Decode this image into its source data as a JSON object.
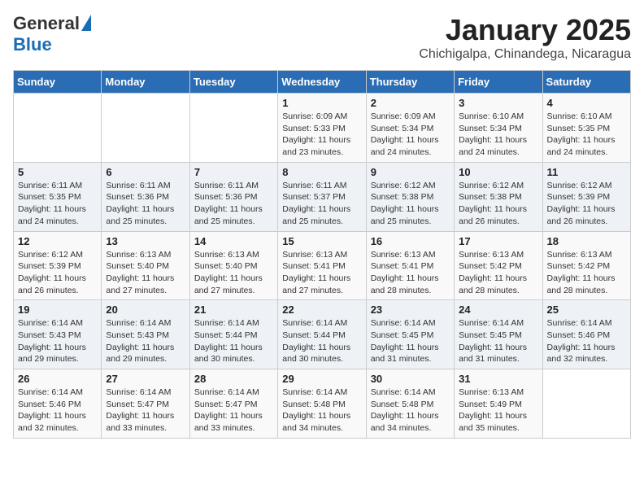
{
  "logo": {
    "general": "General",
    "blue": "Blue"
  },
  "title": "January 2025",
  "subtitle": "Chichigalpa, Chinandega, Nicaragua",
  "days_of_week": [
    "Sunday",
    "Monday",
    "Tuesday",
    "Wednesday",
    "Thursday",
    "Friday",
    "Saturday"
  ],
  "weeks": [
    [
      {
        "day": "",
        "info": ""
      },
      {
        "day": "",
        "info": ""
      },
      {
        "day": "",
        "info": ""
      },
      {
        "day": "1",
        "info": "Sunrise: 6:09 AM\nSunset: 5:33 PM\nDaylight: 11 hours and 23 minutes."
      },
      {
        "day": "2",
        "info": "Sunrise: 6:09 AM\nSunset: 5:34 PM\nDaylight: 11 hours and 24 minutes."
      },
      {
        "day": "3",
        "info": "Sunrise: 6:10 AM\nSunset: 5:34 PM\nDaylight: 11 hours and 24 minutes."
      },
      {
        "day": "4",
        "info": "Sunrise: 6:10 AM\nSunset: 5:35 PM\nDaylight: 11 hours and 24 minutes."
      }
    ],
    [
      {
        "day": "5",
        "info": "Sunrise: 6:11 AM\nSunset: 5:35 PM\nDaylight: 11 hours and 24 minutes."
      },
      {
        "day": "6",
        "info": "Sunrise: 6:11 AM\nSunset: 5:36 PM\nDaylight: 11 hours and 25 minutes."
      },
      {
        "day": "7",
        "info": "Sunrise: 6:11 AM\nSunset: 5:36 PM\nDaylight: 11 hours and 25 minutes."
      },
      {
        "day": "8",
        "info": "Sunrise: 6:11 AM\nSunset: 5:37 PM\nDaylight: 11 hours and 25 minutes."
      },
      {
        "day": "9",
        "info": "Sunrise: 6:12 AM\nSunset: 5:38 PM\nDaylight: 11 hours and 25 minutes."
      },
      {
        "day": "10",
        "info": "Sunrise: 6:12 AM\nSunset: 5:38 PM\nDaylight: 11 hours and 26 minutes."
      },
      {
        "day": "11",
        "info": "Sunrise: 6:12 AM\nSunset: 5:39 PM\nDaylight: 11 hours and 26 minutes."
      }
    ],
    [
      {
        "day": "12",
        "info": "Sunrise: 6:12 AM\nSunset: 5:39 PM\nDaylight: 11 hours and 26 minutes."
      },
      {
        "day": "13",
        "info": "Sunrise: 6:13 AM\nSunset: 5:40 PM\nDaylight: 11 hours and 27 minutes."
      },
      {
        "day": "14",
        "info": "Sunrise: 6:13 AM\nSunset: 5:40 PM\nDaylight: 11 hours and 27 minutes."
      },
      {
        "day": "15",
        "info": "Sunrise: 6:13 AM\nSunset: 5:41 PM\nDaylight: 11 hours and 27 minutes."
      },
      {
        "day": "16",
        "info": "Sunrise: 6:13 AM\nSunset: 5:41 PM\nDaylight: 11 hours and 28 minutes."
      },
      {
        "day": "17",
        "info": "Sunrise: 6:13 AM\nSunset: 5:42 PM\nDaylight: 11 hours and 28 minutes."
      },
      {
        "day": "18",
        "info": "Sunrise: 6:13 AM\nSunset: 5:42 PM\nDaylight: 11 hours and 28 minutes."
      }
    ],
    [
      {
        "day": "19",
        "info": "Sunrise: 6:14 AM\nSunset: 5:43 PM\nDaylight: 11 hours and 29 minutes."
      },
      {
        "day": "20",
        "info": "Sunrise: 6:14 AM\nSunset: 5:43 PM\nDaylight: 11 hours and 29 minutes."
      },
      {
        "day": "21",
        "info": "Sunrise: 6:14 AM\nSunset: 5:44 PM\nDaylight: 11 hours and 30 minutes."
      },
      {
        "day": "22",
        "info": "Sunrise: 6:14 AM\nSunset: 5:44 PM\nDaylight: 11 hours and 30 minutes."
      },
      {
        "day": "23",
        "info": "Sunrise: 6:14 AM\nSunset: 5:45 PM\nDaylight: 11 hours and 31 minutes."
      },
      {
        "day": "24",
        "info": "Sunrise: 6:14 AM\nSunset: 5:45 PM\nDaylight: 11 hours and 31 minutes."
      },
      {
        "day": "25",
        "info": "Sunrise: 6:14 AM\nSunset: 5:46 PM\nDaylight: 11 hours and 32 minutes."
      }
    ],
    [
      {
        "day": "26",
        "info": "Sunrise: 6:14 AM\nSunset: 5:46 PM\nDaylight: 11 hours and 32 minutes."
      },
      {
        "day": "27",
        "info": "Sunrise: 6:14 AM\nSunset: 5:47 PM\nDaylight: 11 hours and 33 minutes."
      },
      {
        "day": "28",
        "info": "Sunrise: 6:14 AM\nSunset: 5:47 PM\nDaylight: 11 hours and 33 minutes."
      },
      {
        "day": "29",
        "info": "Sunrise: 6:14 AM\nSunset: 5:48 PM\nDaylight: 11 hours and 34 minutes."
      },
      {
        "day": "30",
        "info": "Sunrise: 6:14 AM\nSunset: 5:48 PM\nDaylight: 11 hours and 34 minutes."
      },
      {
        "day": "31",
        "info": "Sunrise: 6:13 AM\nSunset: 5:49 PM\nDaylight: 11 hours and 35 minutes."
      },
      {
        "day": "",
        "info": ""
      }
    ]
  ]
}
